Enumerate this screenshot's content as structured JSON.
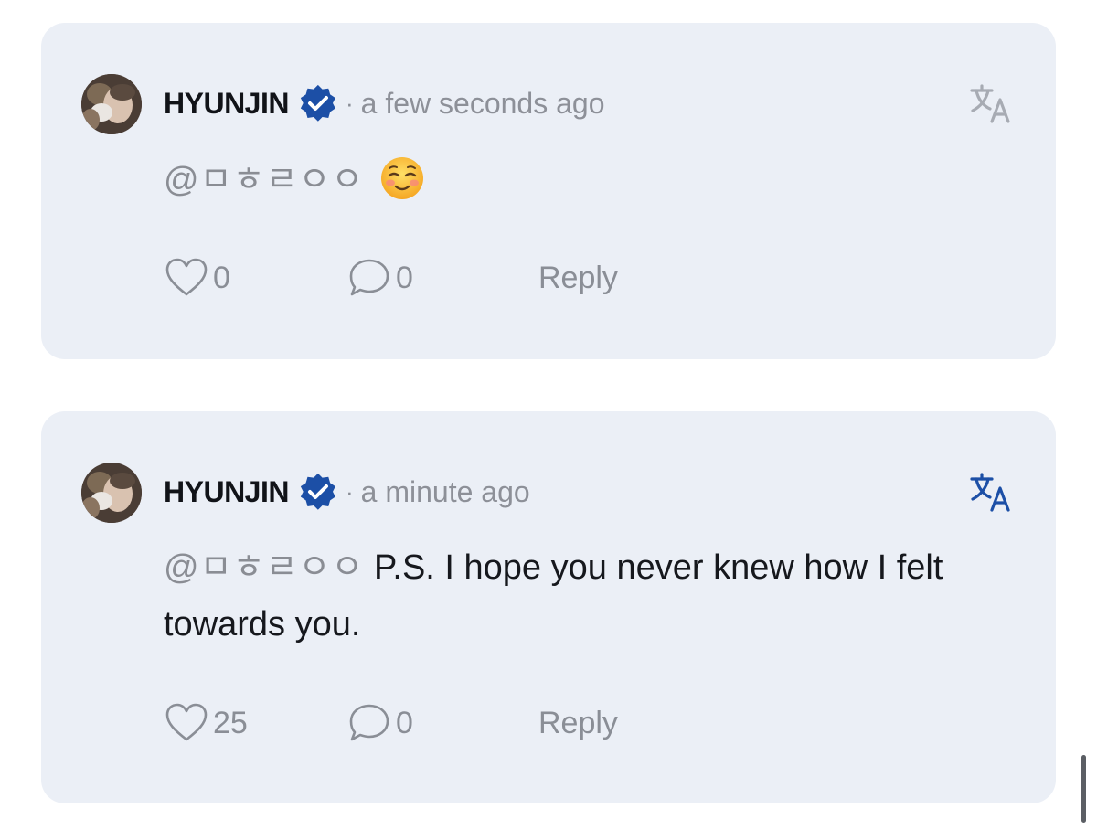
{
  "comments": [
    {
      "username": "HYUNJIN",
      "time": "a few seconds ago",
      "separator": "·",
      "mention": "@ㅁㅎㄹㅇㅇ",
      "text": "",
      "emoji": "smiling-face-emoji",
      "likes": "0",
      "comments": "0",
      "reply_label": "Reply",
      "translate_active": false
    },
    {
      "username": "HYUNJIN",
      "time": "a minute ago",
      "separator": "·",
      "mention": "@ㅁㅎㄹㅇㅇ",
      "text": "P.S. I hope you never knew how I felt towards you.",
      "likes": "25",
      "comments": "0",
      "reply_label": "Reply",
      "translate_active": true
    }
  ],
  "colors": {
    "card_background": "#ebeff6",
    "verified_badge": "#1c4fa6",
    "translate_active": "#1c4fa6",
    "translate_inactive": "#a7abb3",
    "muted_text": "#8a8e96"
  },
  "icons": {
    "verified": "verified-badge-icon",
    "translate": "translate-icon",
    "like": "heart-outline-icon",
    "comment": "speech-bubble-icon"
  }
}
